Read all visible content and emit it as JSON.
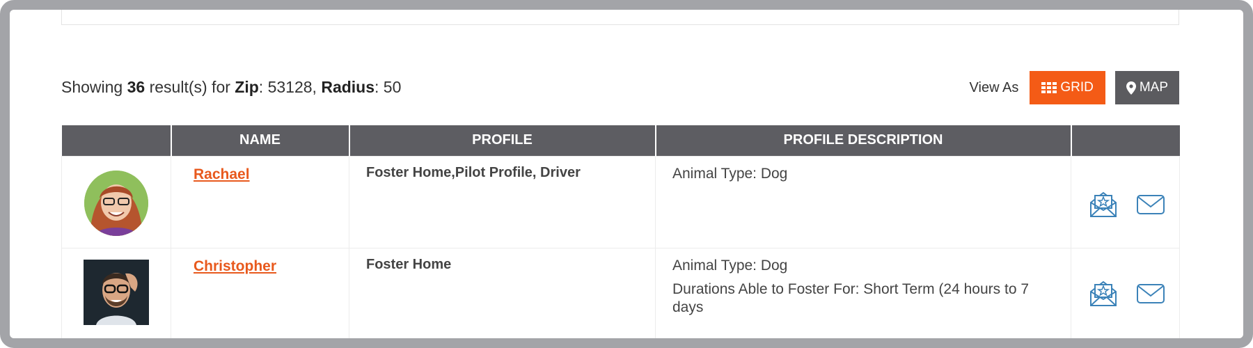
{
  "results": {
    "prefix": "Showing",
    "count": "36",
    "mid": "result(s) for",
    "zip_label": "Zip",
    "zip_value": ": 53128,",
    "radius_label": "Radius",
    "radius_value": ": 50"
  },
  "view": {
    "label": "View As",
    "grid_label": "GRID",
    "map_label": "MAP",
    "grid_color": "#f45b16",
    "map_color": "#5b5b5f"
  },
  "table": {
    "headers": [
      "",
      "NAME",
      "PROFILE",
      "PROFILE DESCRIPTION",
      ""
    ],
    "rows": [
      {
        "name": "Rachael",
        "profile": "Foster Home,Pilot Profile, Driver",
        "description": [
          "Animal Type: Dog"
        ],
        "actions": [
          "invite-envelope-icon",
          "mail-icon"
        ]
      },
      {
        "name": "Christopher",
        "profile": "Foster Home",
        "description": [
          "Animal Type: Dog",
          "Durations Able to Foster For: Short Term (24 hours to 7 days"
        ],
        "actions": [
          "invite-envelope-icon",
          "mail-icon"
        ]
      }
    ]
  },
  "colors": {
    "accent": "#e8591d",
    "header_bg": "#5d5d62",
    "icon_blue": "#3b82b8"
  }
}
